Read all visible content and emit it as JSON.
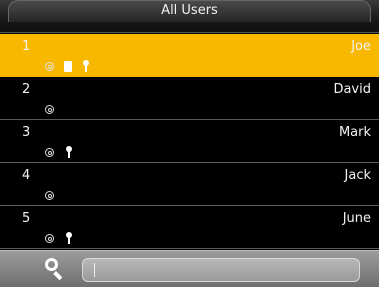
{
  "header": {
    "title": "All Users"
  },
  "users": [
    {
      "number": "1",
      "name": "Joe",
      "selected": true,
      "icons": [
        "fingerprint-icon",
        "card-icon",
        "key-icon"
      ]
    },
    {
      "number": "2",
      "name": "David",
      "selected": false,
      "icons": [
        "fingerprint-icon"
      ]
    },
    {
      "number": "3",
      "name": "Mark",
      "selected": false,
      "icons": [
        "fingerprint-icon",
        "key-icon"
      ]
    },
    {
      "number": "4",
      "name": "Jack",
      "selected": false,
      "icons": [
        "fingerprint-icon"
      ]
    },
    {
      "number": "5",
      "name": "June",
      "selected": false,
      "icons": [
        "fingerprint-icon",
        "key-icon"
      ]
    }
  ],
  "search": {
    "value": "",
    "placeholder": ""
  },
  "colors": {
    "selected_row": "#f9b800",
    "background": "#000000",
    "text": "#f2f2f2"
  }
}
